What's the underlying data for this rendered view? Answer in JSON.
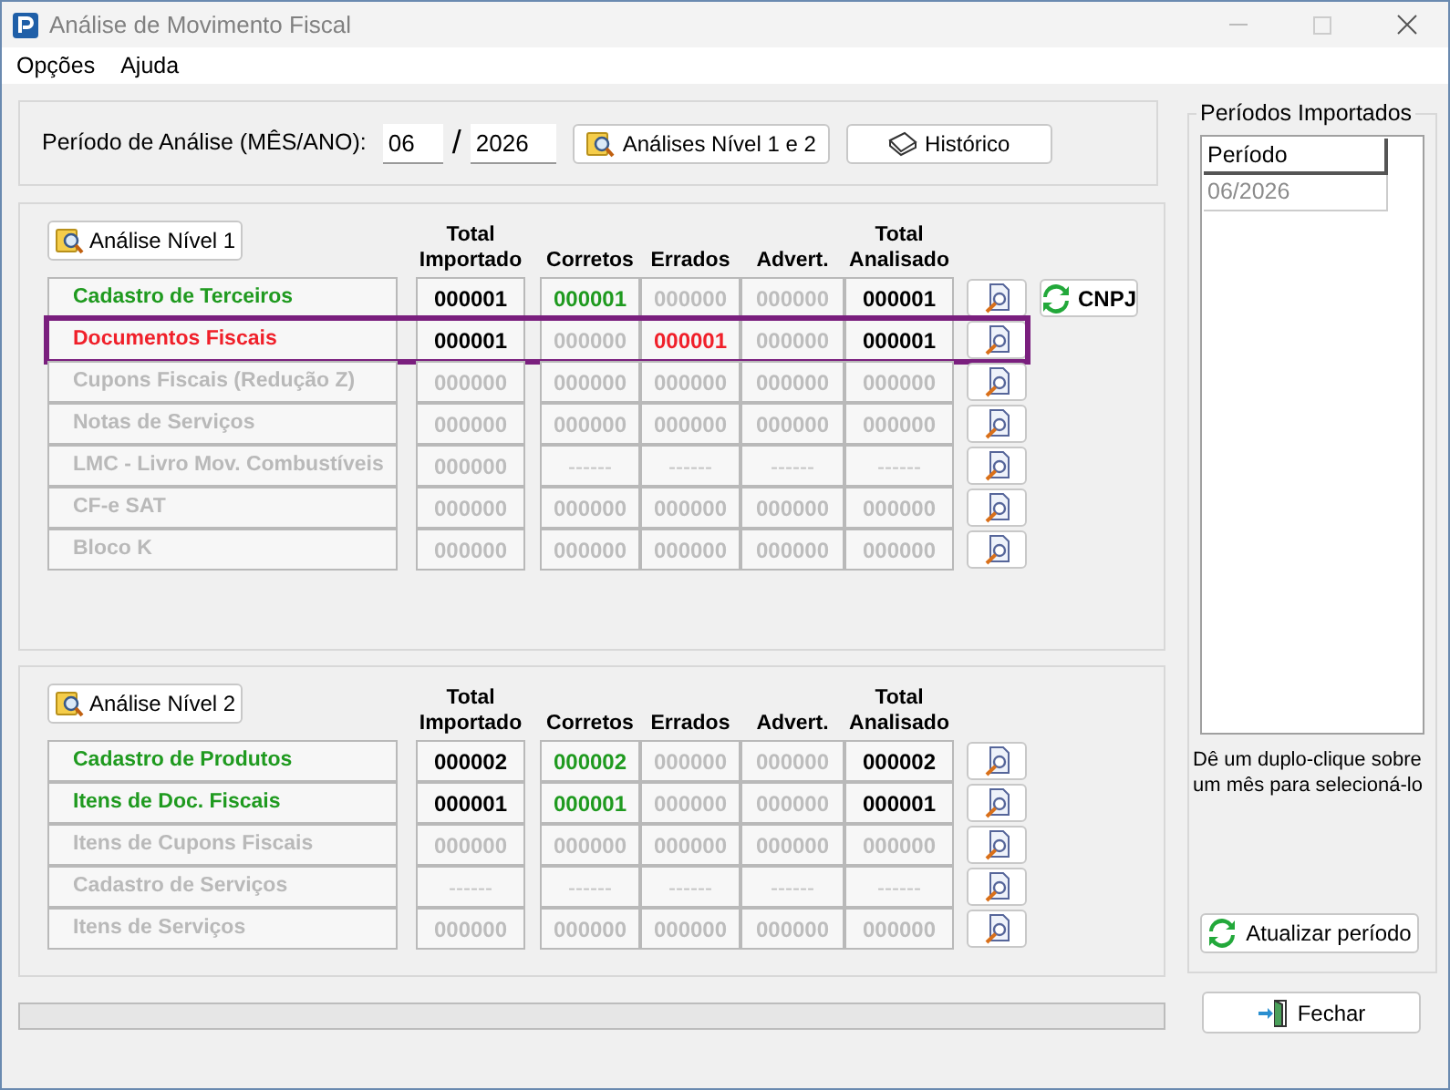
{
  "window": {
    "title": "Análise de Movimento Fiscal"
  },
  "menu": [
    "Opções",
    "Ajuda"
  ],
  "period": {
    "label": "Período de Análise (MÊS/ANO):",
    "month": "06",
    "separator": "/",
    "year": "2026"
  },
  "toolbar": [
    {
      "label": "Análises Nível 1 e 2",
      "kind": "analysis"
    },
    {
      "label": "Histórico",
      "kind": "history"
    }
  ],
  "sections": [
    {
      "button": "Análise Nível 1",
      "columns": [
        "Total Importado",
        "Corretos",
        "Errados",
        "Advert.",
        "Total Analisado"
      ],
      "rows": [
        {
          "name": "Cadastro de Terceiros",
          "kind": "ok",
          "selected": false,
          "cells": [
            {
              "text": "000001",
              "kind": "total"
            },
            {
              "text": "000001",
              "kind": "ok"
            },
            {
              "text": "000000",
              "kind": "muted"
            },
            {
              "text": "000000",
              "kind": "muted"
            },
            {
              "text": "000001",
              "kind": "total"
            }
          ],
          "extra_button": "CNPJ"
        },
        {
          "name": "Documentos Fiscais",
          "kind": "error",
          "selected": true,
          "cells": [
            {
              "text": "000001",
              "kind": "total"
            },
            {
              "text": "000000",
              "kind": "muted"
            },
            {
              "text": "000001",
              "kind": "error"
            },
            {
              "text": "000000",
              "kind": "muted"
            },
            {
              "text": "000001",
              "kind": "total"
            }
          ]
        },
        {
          "name": "Cupons Fiscais (Redução Z)",
          "kind": "inactive",
          "selected": false,
          "cells": [
            {
              "text": "000000",
              "kind": "muted"
            },
            {
              "text": "000000",
              "kind": "muted"
            },
            {
              "text": "000000",
              "kind": "muted"
            },
            {
              "text": "000000",
              "kind": "muted"
            },
            {
              "text": "000000",
              "kind": "muted"
            }
          ]
        },
        {
          "name": "Notas de Serviços",
          "kind": "inactive",
          "selected": false,
          "cells": [
            {
              "text": "000000",
              "kind": "muted"
            },
            {
              "text": "000000",
              "kind": "muted"
            },
            {
              "text": "000000",
              "kind": "muted"
            },
            {
              "text": "000000",
              "kind": "muted"
            },
            {
              "text": "000000",
              "kind": "muted"
            }
          ]
        },
        {
          "name": "LMC - Livro Mov. Combustíveis",
          "kind": "inactive",
          "selected": false,
          "cells": [
            {
              "text": "000000",
              "kind": "muted"
            },
            {
              "text": "------",
              "kind": "dash"
            },
            {
              "text": "------",
              "kind": "dash"
            },
            {
              "text": "------",
              "kind": "dash"
            },
            {
              "text": "------",
              "kind": "dash"
            }
          ]
        },
        {
          "name": "CF-e SAT",
          "kind": "inactive",
          "selected": false,
          "cells": [
            {
              "text": "000000",
              "kind": "muted"
            },
            {
              "text": "000000",
              "kind": "muted"
            },
            {
              "text": "000000",
              "kind": "muted"
            },
            {
              "text": "000000",
              "kind": "muted"
            },
            {
              "text": "000000",
              "kind": "muted"
            }
          ]
        },
        {
          "name": "Bloco K",
          "kind": "inactive",
          "selected": false,
          "cells": [
            {
              "text": "000000",
              "kind": "muted"
            },
            {
              "text": "000000",
              "kind": "muted"
            },
            {
              "text": "000000",
              "kind": "muted"
            },
            {
              "text": "000000",
              "kind": "muted"
            },
            {
              "text": "000000",
              "kind": "muted"
            }
          ]
        }
      ]
    },
    {
      "button": "Análise Nível 2",
      "columns": [
        "Total Importado",
        "Corretos",
        "Errados",
        "Advert.",
        "Total Analisado"
      ],
      "rows": [
        {
          "name": "Cadastro de Produtos",
          "kind": "ok",
          "selected": false,
          "cells": [
            {
              "text": "000002",
              "kind": "total"
            },
            {
              "text": "000002",
              "kind": "ok"
            },
            {
              "text": "000000",
              "kind": "muted"
            },
            {
              "text": "000000",
              "kind": "muted"
            },
            {
              "text": "000002",
              "kind": "total"
            }
          ]
        },
        {
          "name": "Itens de Doc. Fiscais",
          "kind": "ok",
          "selected": false,
          "cells": [
            {
              "text": "000001",
              "kind": "total"
            },
            {
              "text": "000001",
              "kind": "ok"
            },
            {
              "text": "000000",
              "kind": "muted"
            },
            {
              "text": "000000",
              "kind": "muted"
            },
            {
              "text": "000001",
              "kind": "total"
            }
          ]
        },
        {
          "name": "Itens de Cupons Fiscais",
          "kind": "inactive",
          "selected": false,
          "cells": [
            {
              "text": "000000",
              "kind": "muted"
            },
            {
              "text": "000000",
              "kind": "muted"
            },
            {
              "text": "000000",
              "kind": "muted"
            },
            {
              "text": "000000",
              "kind": "muted"
            },
            {
              "text": "000000",
              "kind": "muted"
            }
          ]
        },
        {
          "name": "Cadastro de Serviços",
          "kind": "inactive",
          "selected": false,
          "cells": [
            {
              "text": "------",
              "kind": "dash"
            },
            {
              "text": "------",
              "kind": "dash"
            },
            {
              "text": "------",
              "kind": "dash"
            },
            {
              "text": "------",
              "kind": "dash"
            },
            {
              "text": "------",
              "kind": "dash"
            }
          ]
        },
        {
          "name": "Itens de Serviços",
          "kind": "inactive",
          "selected": false,
          "cells": [
            {
              "text": "000000",
              "kind": "muted"
            },
            {
              "text": "000000",
              "kind": "muted"
            },
            {
              "text": "000000",
              "kind": "muted"
            },
            {
              "text": "000000",
              "kind": "muted"
            },
            {
              "text": "000000",
              "kind": "muted"
            }
          ]
        }
      ]
    }
  ],
  "progress": {
    "level": 0
  },
  "periods": {
    "title": "Períodos Importados",
    "column": "Período",
    "rows": [
      "06/2026"
    ],
    "hint": "Dê um duplo-clique sobre um mês para selecioná-lo",
    "refresh_button": "Atualizar período"
  },
  "close_button": "Fechar"
}
